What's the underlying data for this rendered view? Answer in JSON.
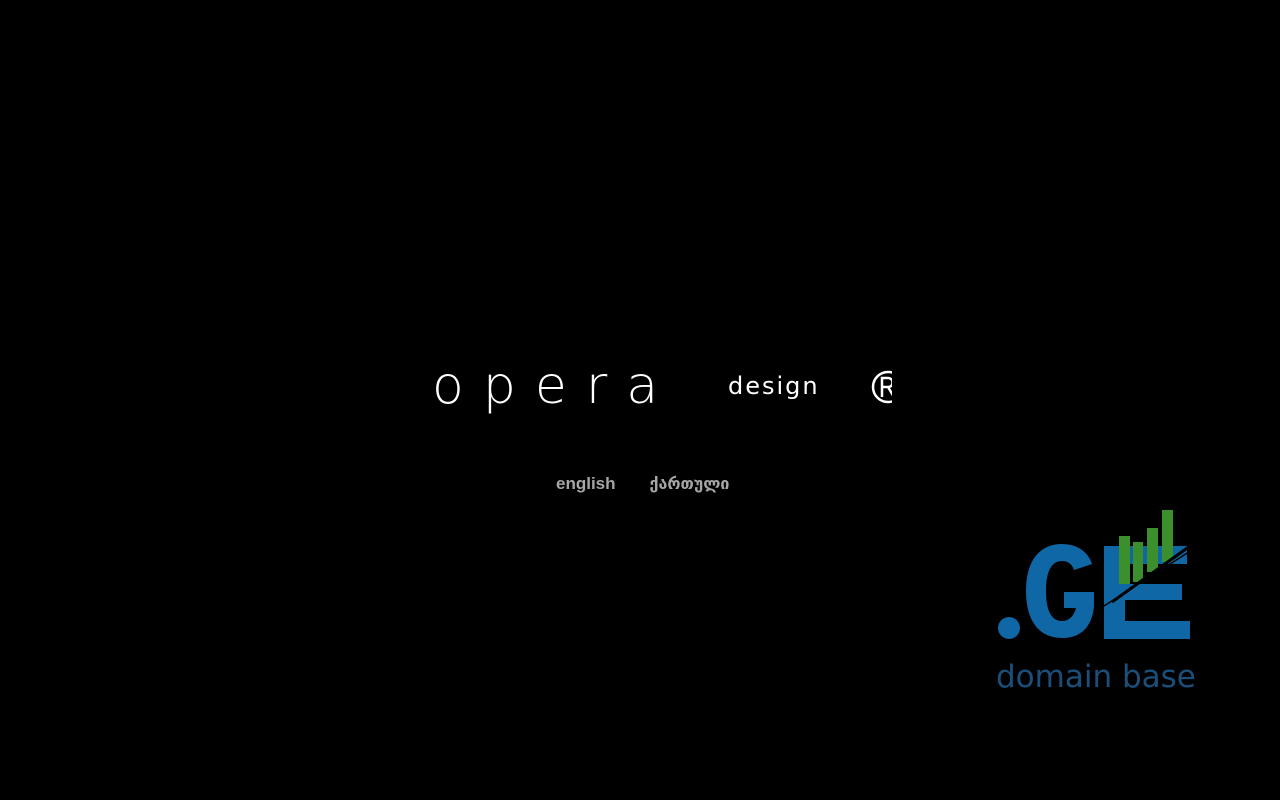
{
  "logo": {
    "name": "opera",
    "tagline": "design"
  },
  "languages": {
    "english": "english",
    "georgian": "ქართული"
  },
  "domain_badge": {
    "tld": ".GE",
    "caption": "domain base",
    "colors": {
      "blue": "#0f67a6",
      "green": "#3c8f2d",
      "caption": "#1b4f7a"
    }
  }
}
